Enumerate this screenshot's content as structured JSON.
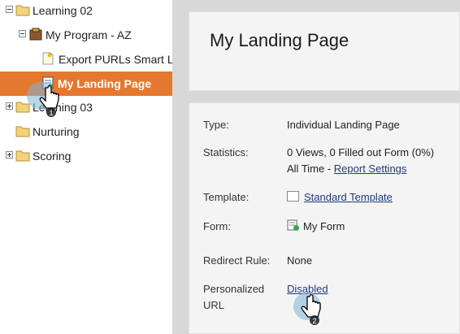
{
  "tree": {
    "learning02": "Learning 02",
    "my_program": "My Program - AZ",
    "export_purls": "Export PURLs Smart List",
    "my_landing_page": "My Landing Page",
    "learning03": "Learning 03",
    "nurturing": "Nurturing",
    "scoring": "Scoring"
  },
  "page": {
    "title": "My Landing Page"
  },
  "details": {
    "type_label": "Type:",
    "type_value": "Individual Landing Page",
    "statistics_label": "Statistics:",
    "statistics_value": "0 Views, 0 Filled out Form (0%)",
    "statistics_range": "All Time -",
    "report_settings_link": "Report Settings",
    "template_label": "Template:",
    "template_value": "Standard Template",
    "form_label": "Form:",
    "form_value": "My Form",
    "redirect_label": "Redirect Rule:",
    "redirect_value": "None",
    "purl_label_line1": "Personalized",
    "purl_label_line2": "URL",
    "purl_value": "Disabled"
  },
  "callouts": {
    "step1": "1",
    "step2": "2"
  },
  "colors": {
    "selected_row": "#e5782f",
    "link": "#1f3a78",
    "panel_bg": "#d8d8d8"
  },
  "icons": [
    "folder-icon",
    "program-icon",
    "smart-list-icon",
    "landing-page-icon",
    "form-icon",
    "template-icon",
    "hand-cursor-icon"
  ]
}
